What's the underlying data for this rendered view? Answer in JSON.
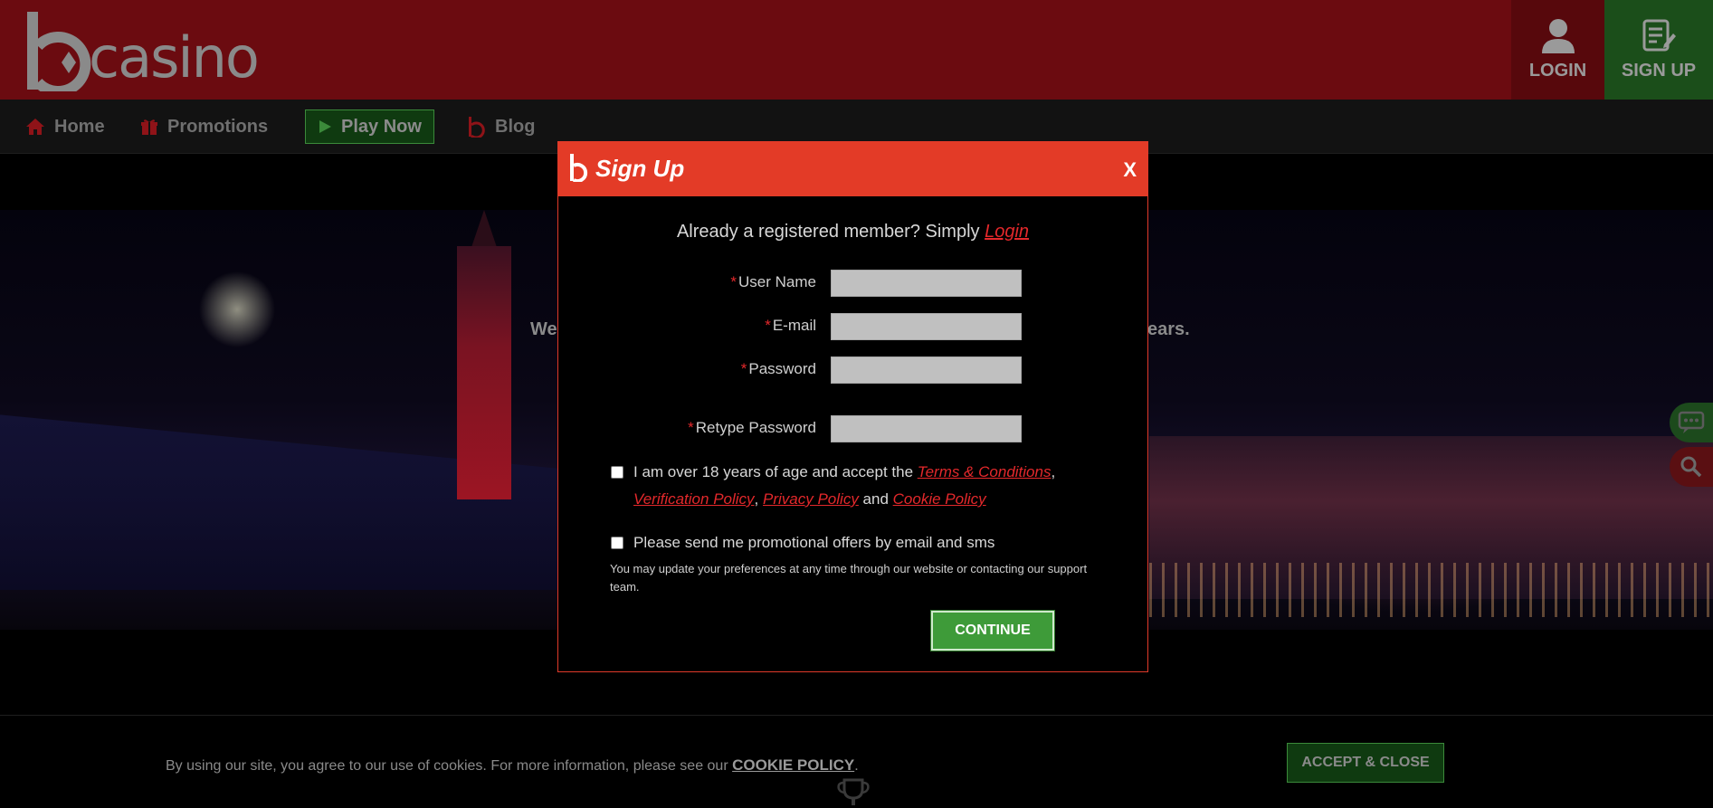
{
  "header": {
    "logo_text": "casino",
    "login_label": "LOGIN",
    "signup_label": "SIGN UP"
  },
  "nav": {
    "home": "Home",
    "promotions": "Promotions",
    "play_now": "Play Now",
    "blog": "Blog"
  },
  "hero": {
    "text_left": "We",
    "text_right": "ears."
  },
  "modal": {
    "title": "Sign Up",
    "close": "X",
    "already_text": "Already a registered member? Simply ",
    "login_link": "Login",
    "fields": [
      {
        "label": "User Name",
        "value": "",
        "placeholder": ""
      },
      {
        "label": "E-mail",
        "value": "",
        "placeholder": ""
      },
      {
        "label": "Password",
        "value": "",
        "placeholder": ""
      },
      {
        "label": "Retype Password",
        "value": "",
        "placeholder": ""
      }
    ],
    "terms": {
      "prefix": "I am over 18 years of age and accept the ",
      "terms_link": "Terms & Conditions",
      "comma1": ",",
      "verification_link": "Verification Policy",
      "comma2": ",",
      "privacy_link": "Privacy Policy",
      "and": " and ",
      "cookie_link": "Cookie Policy"
    },
    "promo_label": "Please send me promotional offers by email and sms",
    "note": "You may update your preferences at any time through our website or contacting our support team.",
    "continue_label": "CONTINUE"
  },
  "cookie_bar": {
    "text": "By using our site, you agree to our use of cookies. For more information, please see our ",
    "link": "COOKIE POLICY",
    "period": ".",
    "accept_label": "ACCEPT & CLOSE"
  },
  "colors": {
    "header_bg": "#6b0b10",
    "modal_header": "#e33b27",
    "accent_red": "#e3282b",
    "continue_green": "#3e9b39"
  }
}
